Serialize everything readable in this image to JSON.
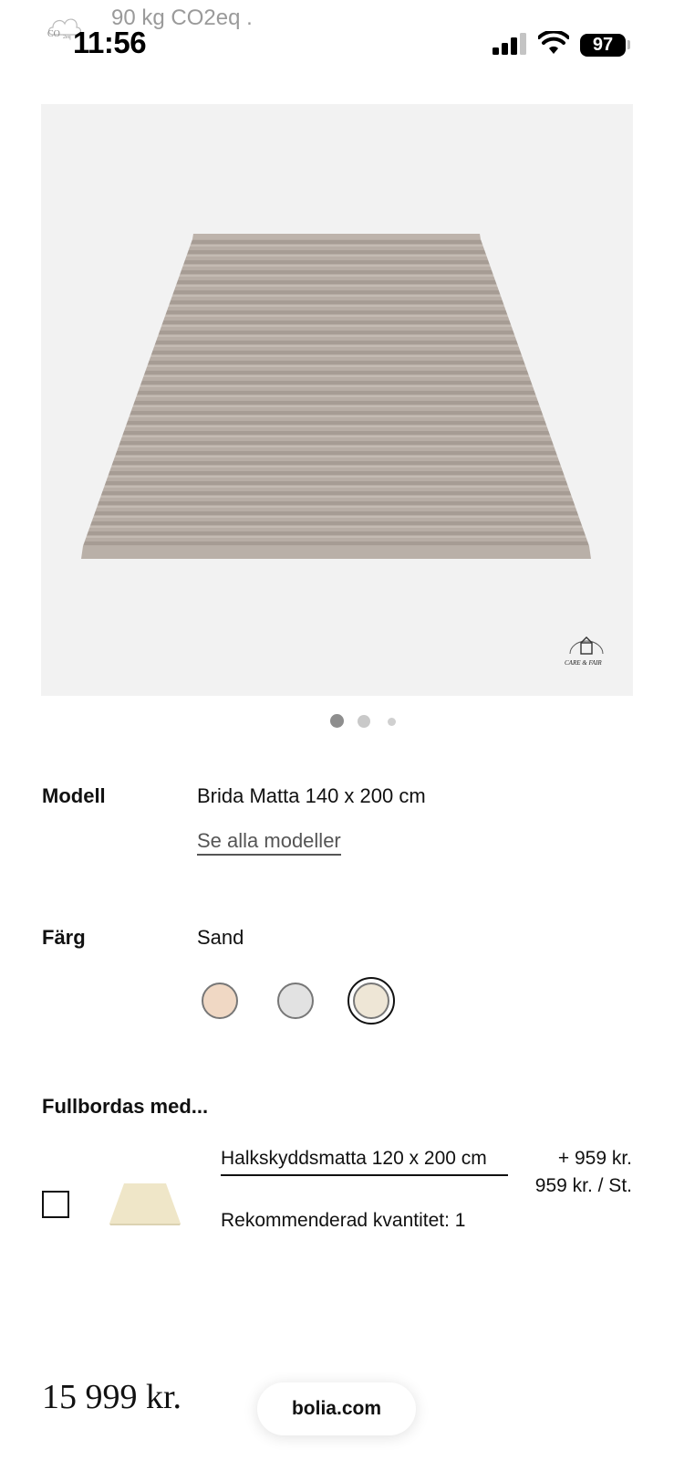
{
  "status_bar": {
    "co2_text": "90 kg CO2eq .",
    "time": "11:56",
    "battery": "97"
  },
  "gallery": {
    "image_count": 3,
    "active_index": 0
  },
  "attributes": {
    "model_label": "Modell",
    "model_value": "Brida Matta 140 x 200 cm",
    "see_all_link": "Se alla modeller",
    "color_label": "Färg",
    "color_value": "Sand",
    "swatches": [
      {
        "name": "peach",
        "color": "#f0d8c4",
        "selected": false
      },
      {
        "name": "grey",
        "color": "#e2e2e2",
        "selected": false
      },
      {
        "name": "sand",
        "color": "#eee6d6",
        "selected": true
      }
    ]
  },
  "complete_with": {
    "title": "Fullbordas med...",
    "item": {
      "name": "Halkskyddsmatta 120 x 200 cm",
      "recommended": "Rekommenderad kvantitet: 1",
      "price_add": "+ 959 kr.",
      "price_unit": "959 kr. / St.",
      "checked": false
    }
  },
  "footer": {
    "total_price": "15 999 kr.",
    "url": "bolia.com"
  }
}
